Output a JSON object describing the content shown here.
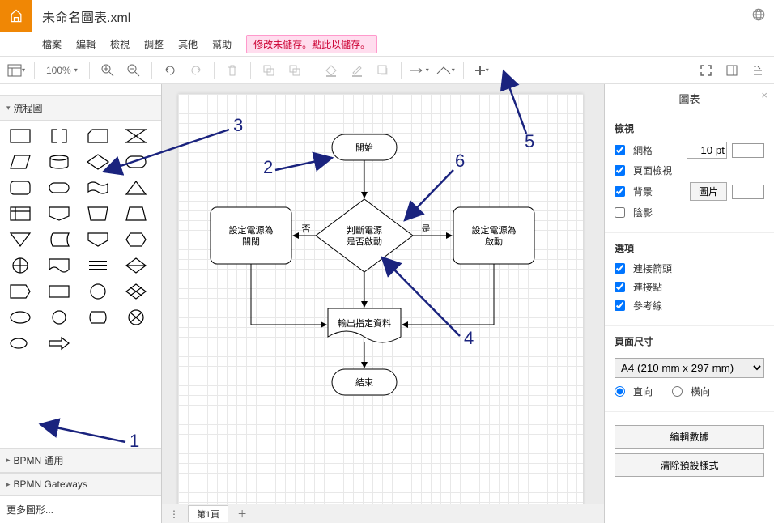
{
  "title": "未命名圖表.xml",
  "menus": [
    "檔案",
    "編輯",
    "檢視",
    "調整",
    "其他",
    "幫助"
  ],
  "save_warning": "修改未儲存。點此以儲存。",
  "zoom": "100%",
  "left_top_cut": "",
  "section_flowchart": "流程圖",
  "section_bpmn": "BPMN 通用",
  "section_bpmn_gw": "BPMN Gateways",
  "more_shapes": "更多圖形...",
  "page_tab": "第1頁",
  "flowchart": {
    "start": "開始",
    "decision_line1": "判斷電源",
    "decision_line2": "是否啟動",
    "off_line1": "設定電源為",
    "off_line2": "關閉",
    "on_line1": "設定電源為",
    "on_line2": "啟動",
    "output": "輸出指定資料",
    "end": "結束",
    "yes": "是",
    "no": "否"
  },
  "right_panel": {
    "title": "圖表",
    "sec_view": "檢視",
    "grid": "網格",
    "grid_value": "10 pt",
    "pageview": "頁面檢視",
    "background": "背景",
    "background_btn": "圖片",
    "shadow": "陰影",
    "sec_options": "選項",
    "conn_arrows": "連接箭頭",
    "conn_points": "連接點",
    "guide_lines": "參考線",
    "sec_page": "頁面尺寸",
    "page_size": "A4 (210 mm x 297 mm)",
    "portrait": "直向",
    "landscape": "橫向",
    "edit_data": "編輯數據",
    "clear_style": "清除預設樣式"
  },
  "annotations": [
    "1",
    "2",
    "3",
    "4",
    "5",
    "6"
  ]
}
